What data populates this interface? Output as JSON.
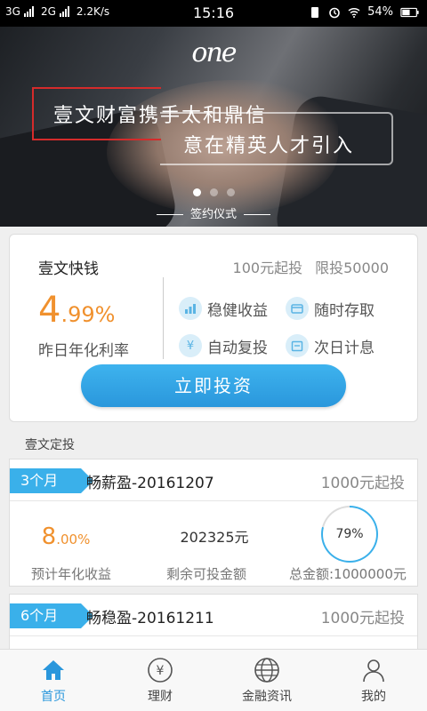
{
  "status_bar": {
    "network_1": "3G",
    "network_2": "2G",
    "speed": "2.2K/s",
    "time": "15:16",
    "battery": "54%"
  },
  "banner": {
    "logo": "one",
    "line1": "壹文财富携手太和鼎信",
    "line2": "意在精英人才引入",
    "caption": "签约仪式",
    "slide_count": 3,
    "active_slide": 1
  },
  "featured": {
    "name": "壹文快钱",
    "min_invest": "100元起投",
    "limit": "限投50000",
    "rate_int": "4",
    "rate_dec": ".99%",
    "rate_label": "昨日年化利率",
    "features": [
      "稳健收益",
      "随时存取",
      "自动复投",
      "次日计息"
    ],
    "button": "立即投资"
  },
  "fixed_section_title": "壹文定投",
  "fixed_products": [
    {
      "term": "3个月",
      "name": "畅薪盈-20161207",
      "min": "1000元起投",
      "rate_int": "8",
      "rate_dec": ".00%",
      "rate_label": "预计年化收益",
      "remaining": "202325元",
      "remaining_label": "剩余可投金额",
      "total_label": "总金额:1000000元",
      "progress_text": "79%",
      "progress": 0.79
    },
    {
      "term": "6个月",
      "name": "畅稳盈-20161211",
      "min": "1000元起投"
    }
  ],
  "tabs": [
    {
      "label": "首页",
      "icon": "home-icon",
      "active": true
    },
    {
      "label": "理财",
      "icon": "yuan-icon",
      "active": false
    },
    {
      "label": "金融资讯",
      "icon": "globe-icon",
      "active": false
    },
    {
      "label": "我的",
      "icon": "user-icon",
      "active": false
    }
  ],
  "colors": {
    "accent_blue": "#3ab0ea",
    "rate_orange": "#f0912e"
  }
}
